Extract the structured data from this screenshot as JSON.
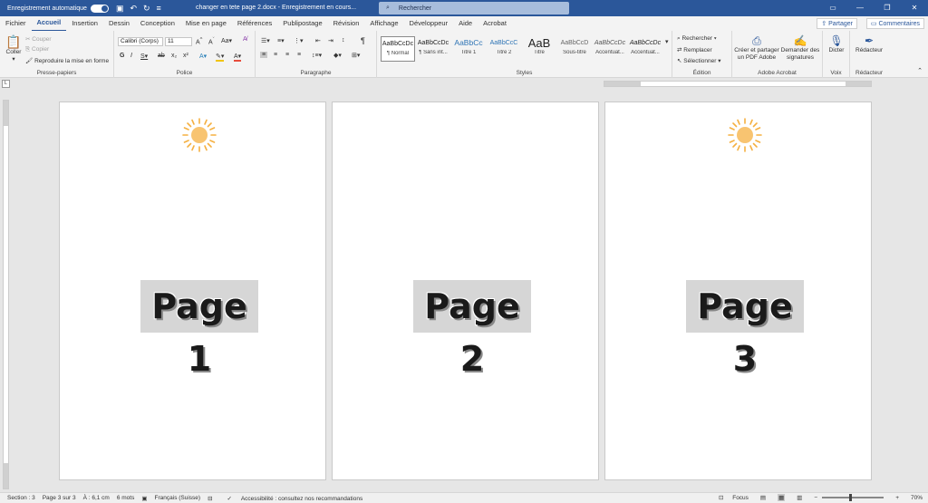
{
  "titlebar": {
    "autosave_label": "Enregistrement automatique",
    "doc_title": "changer en tete page 2.docx  -  Enregistrement en cours...",
    "search_placeholder": "Rechercher"
  },
  "tabs": [
    "Fichier",
    "Accueil",
    "Insertion",
    "Dessin",
    "Conception",
    "Mise en page",
    "Références",
    "Publipostage",
    "Révision",
    "Affichage",
    "Développeur",
    "Aide",
    "Acrobat"
  ],
  "actions": {
    "share": "Partager",
    "comments": "Commentaires"
  },
  "ribbon": {
    "clipboard": {
      "paste": "Coller",
      "cut": "Couper",
      "copy": "Copier",
      "format_painter": "Reproduire la mise en forme",
      "label": "Presse-papiers"
    },
    "font": {
      "font_name": "Calibri (Corps)",
      "font_size": "11",
      "label": "Police"
    },
    "paragraph": {
      "label": "Paragraphe"
    },
    "styles": {
      "label": "Styles",
      "items": [
        {
          "sample": "AaBbCcDc",
          "name": "¶ Normal"
        },
        {
          "sample": "AaBbCcDc",
          "name": "¶ Sans int..."
        },
        {
          "sample": "AaBbCc",
          "name": "Titre 1"
        },
        {
          "sample": "AaBbCcC",
          "name": "Titre 2"
        },
        {
          "sample": "AaB",
          "name": "Titre"
        },
        {
          "sample": "AaBbCcD",
          "name": "Sous-titre"
        },
        {
          "sample": "AaBbCcDc",
          "name": "Accentuat..."
        },
        {
          "sample": "AaBbCcDc",
          "name": "Accentuat..."
        }
      ]
    },
    "editing": {
      "find": "Rechercher",
      "replace": "Remplacer",
      "select": "Sélectionner",
      "label": "Édition"
    },
    "acrobat": {
      "create_pdf": "Créer et partager un PDF Adobe",
      "signatures": "Demander des signatures",
      "label": "Adobe Acrobat"
    },
    "voice": {
      "dictate": "Dicter",
      "label": "Voix"
    },
    "editor": {
      "editor": "Rédacteur",
      "label": "Rédacteur"
    }
  },
  "pages": [
    {
      "label": "Page 1"
    },
    {
      "label": "Page 2"
    },
    {
      "label": "Page 3"
    }
  ],
  "colors": {
    "brand": "#2b579a",
    "sun": "#f5b041"
  },
  "status": {
    "section": "Section : 3",
    "page": "Page 3 sur 3",
    "position": "À : 6,1 cm",
    "words": "6 mots",
    "language": "Français (Suisse)",
    "accessibility": "Accessibilité : consultez nos recommandations",
    "focus": "Focus",
    "zoom": "70%"
  }
}
